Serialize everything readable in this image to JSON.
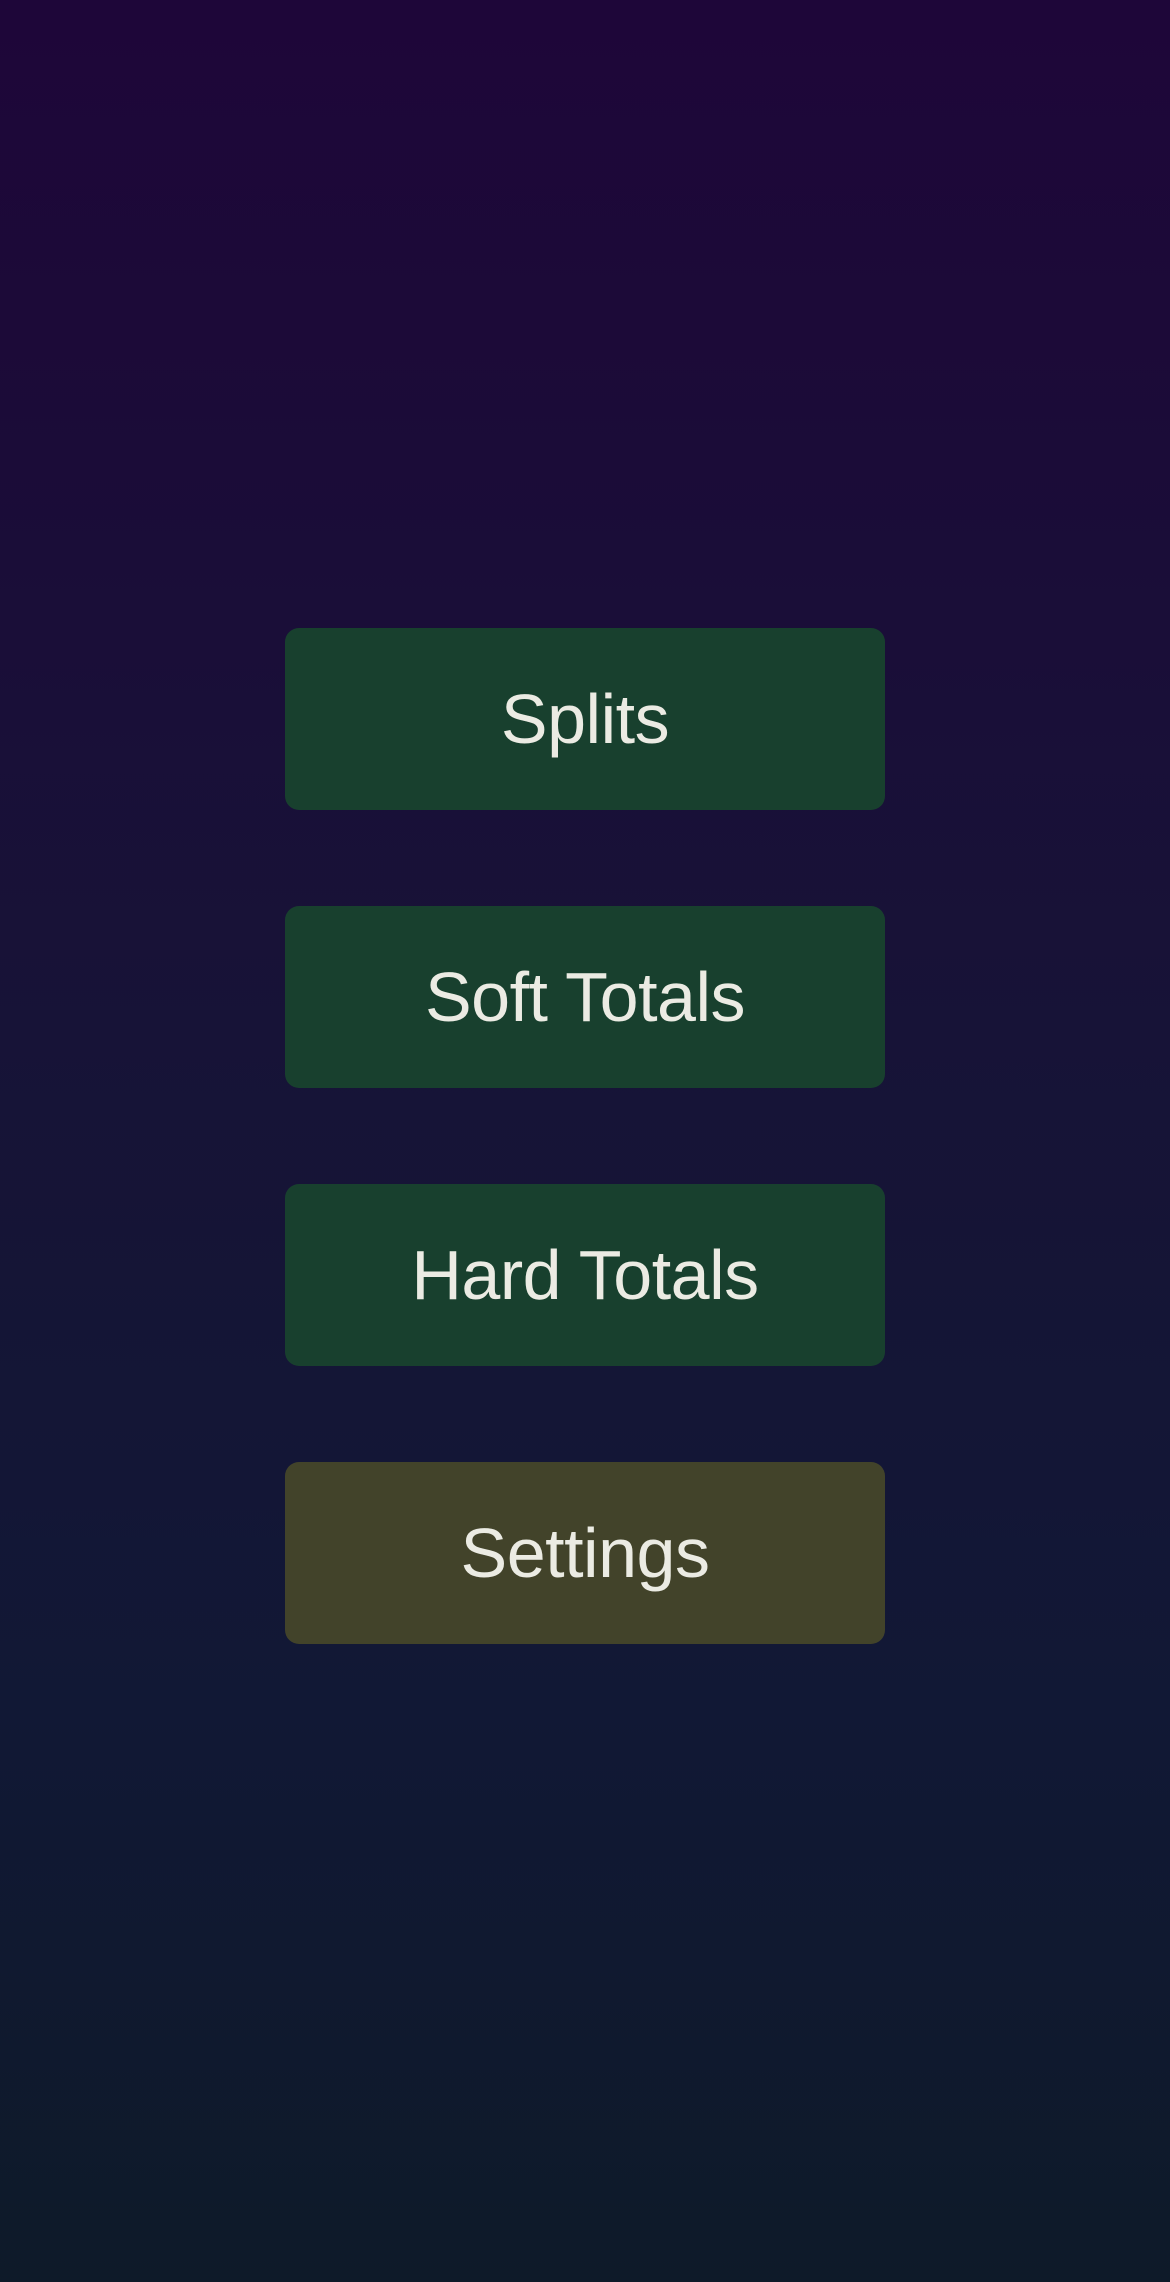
{
  "menu": {
    "items": [
      {
        "label": "Splits",
        "color": "#18402e"
      },
      {
        "label": "Soft Totals",
        "color": "#18402e"
      },
      {
        "label": "Hard Totals",
        "color": "#18402e"
      },
      {
        "label": "Settings",
        "color": "#42432a"
      }
    ]
  },
  "theme": {
    "background_top": "#1e0639",
    "background_bottom": "#0e1a29",
    "text_color": "#ebebe3"
  }
}
